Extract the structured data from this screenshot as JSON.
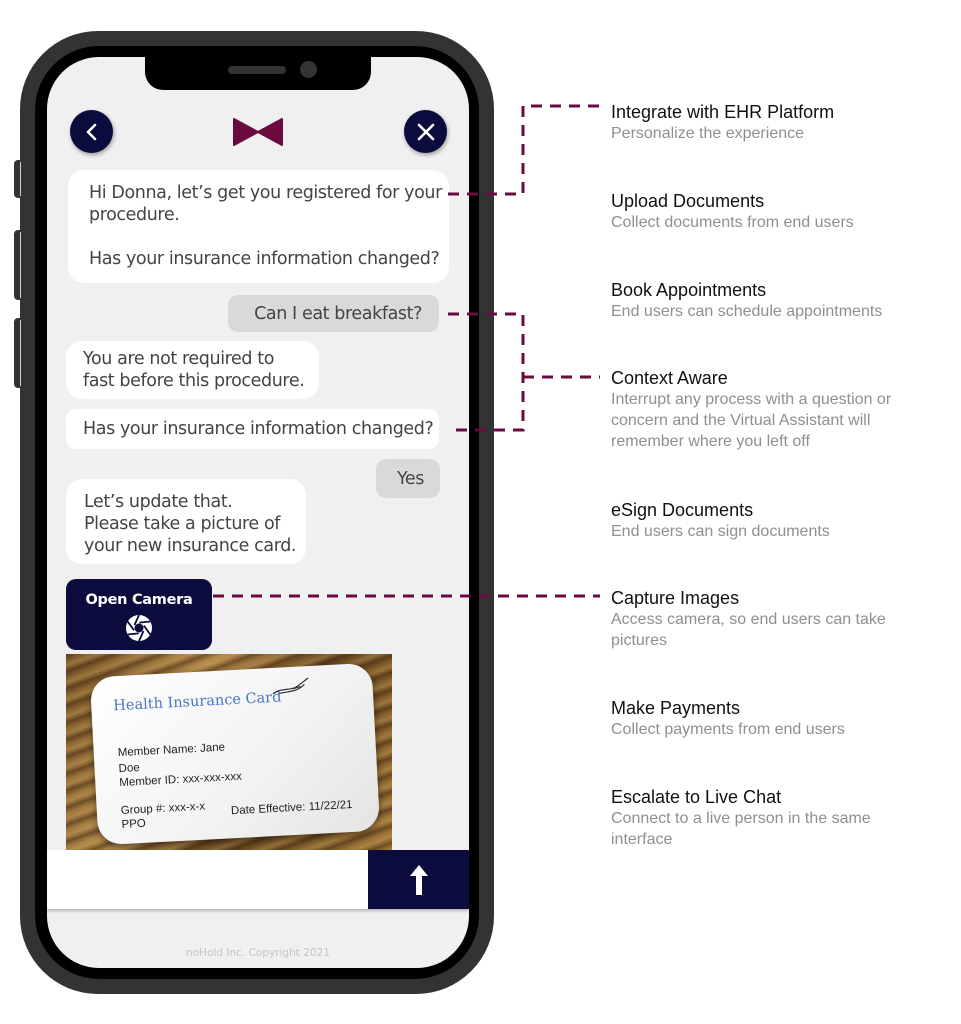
{
  "colors": {
    "navy": "#0b0c3d",
    "brand_maroon": "#6b0a3f",
    "connector": "#6b0a3f",
    "screen_bg": "#f0f0f0",
    "bot_bubble": "#ffffff",
    "user_bubble": "#d9d9d9",
    "feature_title": "#111111",
    "feature_desc": "#8f8f8f"
  },
  "phone": {
    "header": {
      "back_icon": "chevron-left-icon",
      "logo_icon": "bowtie-logo-icon",
      "close_icon": "close-x-icon"
    },
    "messages": [
      {
        "sender": "bot",
        "lines": [
          "Hi Donna, let’s get you registered for your",
          "procedure.",
          "",
          "Has your insurance information changed?"
        ]
      },
      {
        "sender": "user",
        "text": "Can I eat breakfast?"
      },
      {
        "sender": "bot",
        "lines": [
          "You are not required to",
          "fast before this procedure."
        ]
      },
      {
        "sender": "bot",
        "text": "Has your insurance information changed?"
      },
      {
        "sender": "user",
        "text": "Yes"
      },
      {
        "sender": "bot",
        "lines": [
          "Let’s update that.",
          "Please take a picture of",
          "your new insurance card."
        ]
      }
    ],
    "open_camera": {
      "label": "Open Camera",
      "icon": "camera-aperture-icon"
    },
    "insurance_card": {
      "title": "Health Insurance Card",
      "member_name_line1": "Member Name: Jane",
      "member_name_line2": "Doe",
      "member_id": "Member ID: xxx-xxx-xxx",
      "group": "Group #: xxx-x-x",
      "plan": "PPO",
      "date_effective": "Date Effective: 11/22/21"
    },
    "input": {
      "value": "",
      "placeholder": ""
    },
    "send_icon": "arrow-up-icon",
    "copyright": "noHold Inc. Copyright 2021"
  },
  "features": [
    {
      "title": "Integrate with EHR Platform",
      "desc": [
        "Personalize the experience"
      ]
    },
    {
      "title": "Upload Documents",
      "desc": [
        "Collect documents from end users"
      ]
    },
    {
      "title": "Book Appointments",
      "desc": [
        "End users can schedule appointments"
      ]
    },
    {
      "title": "Context Aware",
      "desc": [
        "Interrupt any process with a question or",
        "concern and the Virtual Assistant will",
        "remember where you left off"
      ]
    },
    {
      "title": "eSign Documents",
      "desc": [
        "End users can sign documents"
      ]
    },
    {
      "title": "Capture Images",
      "desc": [
        "Access camera, so end users can take",
        "pictures"
      ]
    },
    {
      "title": "Make Payments",
      "desc": [
        "Collect payments from end users"
      ]
    },
    {
      "title": "Escalate to Live Chat",
      "desc": [
        "Connect to a live person in the same",
        "interface"
      ]
    }
  ]
}
